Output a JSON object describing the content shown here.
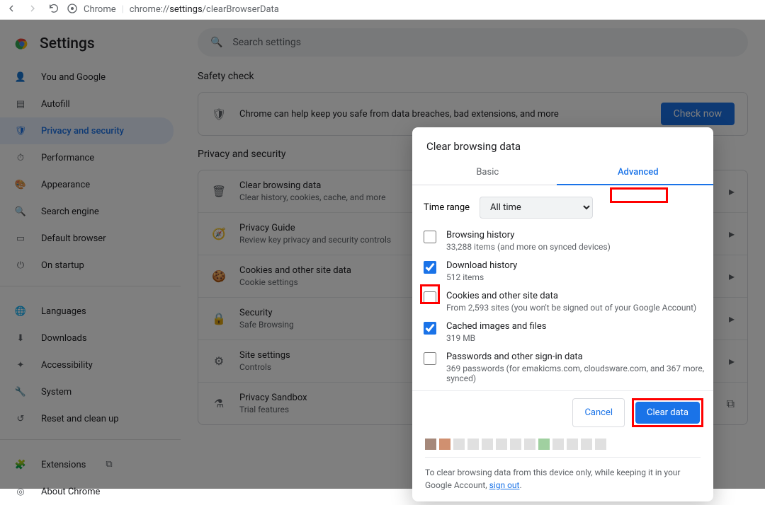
{
  "browser": {
    "url_prefix": "Chrome",
    "url_host": "chrome://",
    "url_path_bold": "settings",
    "url_path_rest": "/clearBrowserData"
  },
  "settings_title": "Settings",
  "search_placeholder": "Search settings",
  "sidebar": {
    "items": [
      {
        "label": "You and Google"
      },
      {
        "label": "Autofill"
      },
      {
        "label": "Privacy and security"
      },
      {
        "label": "Performance"
      },
      {
        "label": "Appearance"
      },
      {
        "label": "Search engine"
      },
      {
        "label": "Default browser"
      },
      {
        "label": "On startup"
      }
    ],
    "items2": [
      {
        "label": "Languages"
      },
      {
        "label": "Downloads"
      },
      {
        "label": "Accessibility"
      },
      {
        "label": "System"
      },
      {
        "label": "Reset and clean up"
      }
    ],
    "items3": [
      {
        "label": "Extensions"
      },
      {
        "label": "About Chrome"
      }
    ]
  },
  "safety": {
    "heading": "Safety check",
    "desc": "Chrome can help keep you safe from data breaches, bad extensions, and more",
    "button": "Check now"
  },
  "privsec": {
    "heading": "Privacy and security",
    "rows": [
      {
        "title": "Clear browsing data",
        "sub": "Clear history, cookies, cache, and more"
      },
      {
        "title": "Privacy Guide",
        "sub": "Review key privacy and security controls"
      },
      {
        "title": "Cookies and other site data",
        "sub": "Cookie settings"
      },
      {
        "title": "Security",
        "sub": "Safe Browsing"
      },
      {
        "title": "Site settings",
        "sub": "Controls"
      },
      {
        "title": "Privacy Sandbox",
        "sub": "Trial features"
      }
    ]
  },
  "dialog": {
    "title": "Clear browsing data",
    "tab_basic": "Basic",
    "tab_advanced": "Advanced",
    "time_range_label": "Time range",
    "time_range_value": "All time",
    "items": [
      {
        "title": "Browsing history",
        "sub": "33,288 items (and more on synced devices)",
        "checked": false
      },
      {
        "title": "Download history",
        "sub": "512 items",
        "checked": true
      },
      {
        "title": "Cookies and other site data",
        "sub": "From 2,593 sites (you won't be signed out of your Google Account)",
        "checked": false
      },
      {
        "title": "Cached images and files",
        "sub": "319 MB",
        "checked": true
      },
      {
        "title": "Passwords and other sign-in data",
        "sub": "369 passwords (for emakicms.com, cloudsware.com, and 367 more, synced)",
        "checked": false
      }
    ],
    "cancel": "Cancel",
    "clear": "Clear data",
    "note_pre": "To clear browsing data from this device only, while keeping it in your Google Account, ",
    "note_link": "sign out",
    "note_post": "."
  }
}
